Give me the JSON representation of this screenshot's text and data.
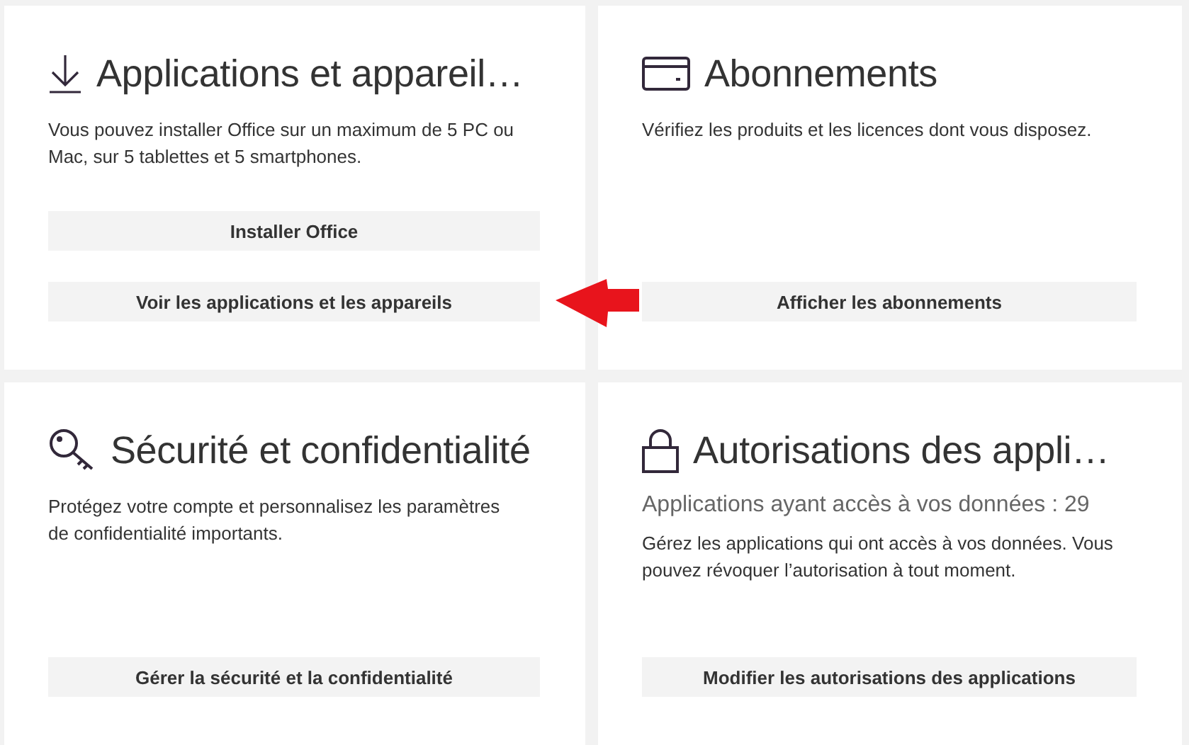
{
  "cards": [
    {
      "title": "Applications et appareil…",
      "description": "Vous pouvez installer Office sur un maximum de 5 PC ou Mac, sur 5 tablettes et 5 smartphones.",
      "buttons": [
        "Installer Office",
        "Voir les applications et les appareils"
      ]
    },
    {
      "title": "Abonnements",
      "description": "Vérifiez les produits et les licences dont vous disposez.",
      "buttons": [
        "Afficher les abonnements"
      ]
    },
    {
      "title": "Sécurité et confidentialité",
      "description": "Protégez votre compte et personnalisez les paramètres de confidentialité importants.",
      "buttons": [
        "Gérer la sécurité et la confidentialité"
      ]
    },
    {
      "title": "Autorisations des appli…",
      "subtitle": "Applications ayant accès à vos données : 29",
      "description": "Gérez les applications qui ont accès à vos données. Vous pouvez révoquer l’autorisation à tout moment.",
      "buttons": [
        "Modifier les autorisations des applications"
      ]
    }
  ]
}
